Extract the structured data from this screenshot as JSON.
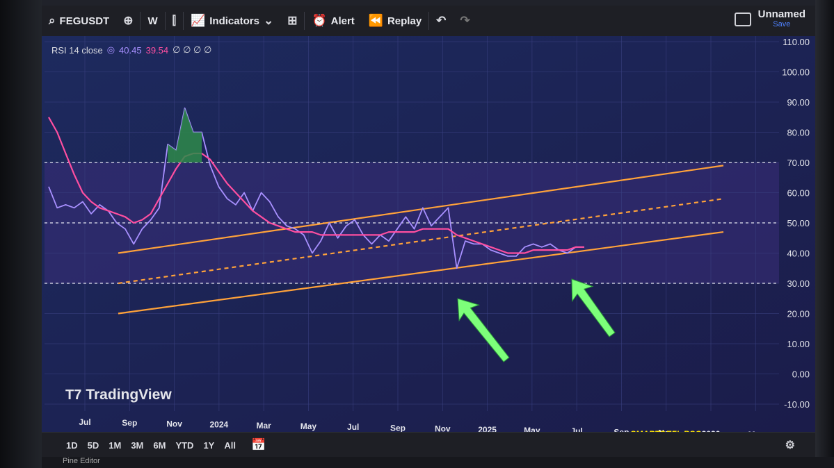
{
  "toolbar": {
    "symbol": "FEGUSDT",
    "interval": "W",
    "indicators_label": "Indicators",
    "alert_label": "Alert",
    "replay_label": "Replay",
    "layout_name": "Unnamed",
    "save_label": "Save"
  },
  "legend": {
    "name": "RSI 14 close",
    "value_rsi": "40.45",
    "value_ma": "39.54",
    "placeholders": "∅ ∅ ∅ ∅"
  },
  "watermark": "TradingView",
  "credit": "SMARTDEFI_BSC",
  "range_buttons": [
    "1D",
    "5D",
    "1M",
    "3M",
    "6M",
    "YTD",
    "1Y",
    "All"
  ],
  "bottom_tab": "Pine Editor",
  "colors": {
    "rsi": "#a890ff",
    "ma": "#ff4fa0",
    "channel": "#ffa23a",
    "arrow": "#7dff7a",
    "band_fill": "#3b2e7a",
    "background": "#1c1f55"
  },
  "chart_data": {
    "type": "line",
    "yaxis_ticks": [
      "110.00",
      "100.00",
      "90.00",
      "80.00",
      "70.00",
      "60.00",
      "50.00",
      "40.00",
      "30.00",
      "20.00",
      "10.00",
      "0.00",
      "-10.00"
    ],
    "xaxis_ticks": [
      "Jul",
      "Sep",
      "Nov",
      "2024",
      "Mar",
      "May",
      "Jul",
      "Sep",
      "Nov",
      "2025",
      "May",
      "Jul",
      "Sep",
      "Nov",
      "2026",
      "Mar"
    ],
    "ylim": [
      -10,
      110
    ],
    "bands": [
      70,
      50,
      30
    ],
    "series": [
      {
        "name": "RSI 14 close",
        "values": [
          62,
          55,
          56,
          55,
          57,
          53,
          56,
          54,
          50,
          48,
          43,
          48,
          51,
          55,
          76,
          74,
          88,
          80,
          80,
          69,
          62,
          58,
          56,
          60,
          54,
          60,
          57,
          52,
          49,
          48,
          46,
          40,
          44,
          50,
          45,
          49,
          51,
          46,
          43,
          46,
          44,
          48,
          52,
          48,
          55,
          49,
          52,
          55,
          35,
          44,
          43,
          43,
          41,
          40,
          39,
          39,
          42,
          43,
          42,
          43,
          41,
          40,
          42,
          42
        ]
      },
      {
        "name": "RSI-based MA",
        "values": [
          85,
          80,
          73,
          66,
          60,
          57,
          55,
          54,
          53,
          52,
          50,
          51,
          53,
          58,
          63,
          68,
          72,
          73,
          73,
          71,
          67,
          63,
          60,
          57,
          54,
          52,
          50,
          49,
          48,
          47,
          47,
          47,
          46,
          46,
          46,
          46,
          46,
          46,
          46,
          46,
          47,
          47,
          47,
          47,
          48,
          48,
          48,
          48,
          46,
          45,
          44,
          43,
          42,
          41,
          40,
          40,
          40,
          41,
          41,
          41,
          41,
          41,
          42,
          42
        ]
      }
    ],
    "channel": {
      "upper": [
        [
          0,
          40
        ],
        [
          1,
          69
        ]
      ],
      "middle": [
        [
          0,
          30
        ],
        [
          1,
          58
        ]
      ],
      "lower": [
        [
          0,
          20
        ],
        [
          1,
          47
        ]
      ]
    },
    "annotations": [
      "arrow",
      "arrow"
    ]
  }
}
